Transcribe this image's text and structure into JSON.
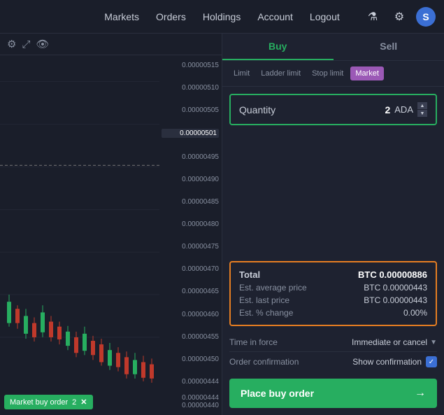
{
  "nav": {
    "links": [
      {
        "label": "Markets",
        "id": "markets"
      },
      {
        "label": "Orders",
        "id": "orders"
      },
      {
        "label": "Holdings",
        "id": "holdings"
      },
      {
        "label": "Account",
        "id": "account"
      },
      {
        "label": "Logout",
        "id": "logout"
      }
    ],
    "icons": {
      "flask": "⚗",
      "gear": "⚙",
      "user_initial": "S"
    }
  },
  "chart": {
    "prices": [
      "0.00000515",
      "0.00000510",
      "0.00000505",
      "0.00000501",
      "0.00000495",
      "0.00000490",
      "0.00000485",
      "0.00000480",
      "0.00000475",
      "0.00000470",
      "0.00000465",
      "0.00000460",
      "0.00000455",
      "0.00000450",
      "0.00000444"
    ],
    "highlighted_price": "0.00000501",
    "bottom_prices": [
      "0.00000444",
      "0.00000440"
    ]
  },
  "market_badge": {
    "label": "Market buy order",
    "quantity": "2",
    "close": "✕"
  },
  "right_panel": {
    "buy_label": "Buy",
    "sell_label": "Sell",
    "order_types": [
      {
        "label": "Limit",
        "active": false
      },
      {
        "label": "Ladder limit",
        "active": false
      },
      {
        "label": "Stop limit",
        "active": false
      },
      {
        "label": "Market",
        "active": true
      }
    ],
    "quantity": {
      "label": "Quantity",
      "value": "2",
      "unit": "ADA"
    },
    "total": {
      "label": "Total",
      "value": "BTC 0.00000886",
      "rows": [
        {
          "label": "Est. average price",
          "value": "BTC 0.00000443"
        },
        {
          "label": "Est. last price",
          "value": "BTC 0.00000443"
        },
        {
          "label": "Est. % change",
          "value": "0.00%"
        }
      ]
    },
    "time_in_force": {
      "label": "Time in force",
      "value": "Immediate or cancel",
      "chevron": "▼"
    },
    "order_confirmation": {
      "label": "Order confirmation",
      "value": "Show confirmation",
      "checked": true,
      "check_mark": "✓"
    },
    "place_order_btn": {
      "label": "Place buy order",
      "arrow": "→"
    }
  }
}
